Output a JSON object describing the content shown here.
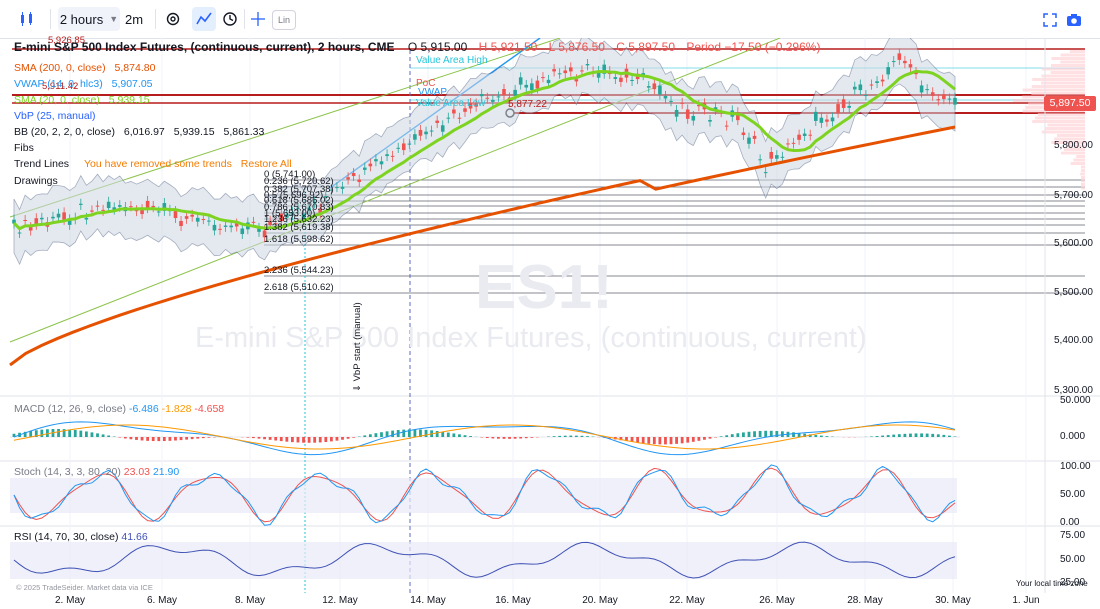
{
  "toolbar": {
    "interval": "2 hours",
    "interval_alt": "2m",
    "lin_label": "Lin"
  },
  "header": {
    "title": "E-mini S&P 500 Index Futures, (continuous, current), 2 hours, CME",
    "open": "O 5,915.00",
    "high": "H 5,921.50",
    "low": "L 5,876.50",
    "close": "C 5,897.50",
    "period": "Period −17.50 (−0.296%)",
    "hi_tag": "5,926.85",
    "level_tag": "5,911.42"
  },
  "legend": {
    "sma200": {
      "label": "SMA (200, 0, close)",
      "value": "5,874.80"
    },
    "vwap": {
      "label": "VWAP (14, 0, hlc3)",
      "value": "5,907.05"
    },
    "sma20": {
      "label": "SMA (20, 0, close)",
      "value": "5,939.15"
    },
    "vbp": {
      "label": "VbP (25, manual)"
    },
    "bb": {
      "label": "BB (20, 2, 2, 0, close)",
      "v1": "6,016.97",
      "v2": "5,939.15",
      "v3": "5,861.33"
    },
    "fibs": "Fibs",
    "trend": "Trend Lines",
    "trend_note": "You have removed some trends",
    "restore": "Restore All",
    "drawings": "Drawings"
  },
  "annotations": {
    "value_area_high": "Value Area High",
    "poc": "PoC",
    "vwap_label": "VWAP",
    "value_area_low": "Value Area Low",
    "point_label": "5,877.22",
    "vbp_start": "⇓ VbP start (manual)"
  },
  "fibs": [
    {
      "text": "0 (5,741.00)"
    },
    {
      "text": "0.236 (5,720.62)"
    },
    {
      "text": "0.382 (5,707.38)"
    },
    {
      "text": "0.5 (5,696.92)"
    },
    {
      "text": "0.618 (5,686.02)"
    },
    {
      "text": "0.786 (5,670.83)"
    },
    {
      "text": "1 (5,653.00)"
    },
    {
      "text": "1.236 (5,632.23)"
    },
    {
      "text": "1.382 (5,619.38)"
    },
    {
      "text": "1.618 (5,598.62)"
    },
    {
      "text": "2.236 (5,544.23)"
    },
    {
      "text": "2.618 (5,510.62)"
    }
  ],
  "price_axis": [
    "5,800.00",
    "5,700.00",
    "5,600.00",
    "5,500.00",
    "5,400.00",
    "5,300.00"
  ],
  "price_tag": "5,897.50",
  "macd": {
    "label": "MACD (12, 26, 9, close)",
    "v1": "-6.486",
    "v2": "-1.828",
    "v3": "-4.658",
    "axis": [
      "50.000",
      "0.000"
    ]
  },
  "stoch": {
    "label": "Stoch (14, 3, 3, 80, 20)",
    "v1": "23.03",
    "v2": "21.90",
    "axis": [
      "100.00",
      "50.00",
      "0.00"
    ]
  },
  "rsi": {
    "label": "RSI (14, 70, 30, close)",
    "v1": "41.66",
    "axis": [
      "75.00",
      "50.00",
      "25.00"
    ]
  },
  "x_axis": [
    "2. May",
    "6. May",
    "8. May",
    "12. May",
    "14. May",
    "16. May",
    "20. May",
    "22. May",
    "26. May",
    "28. May",
    "30. May",
    "1. Jun"
  ],
  "watermark": {
    "symbol": "ES1!",
    "name": "E-mini S&P 500 Index Futures, (continuous, current)"
  },
  "footer": {
    "credit": "© 2025 TradeSeider. Market data via ICE",
    "local_time": "Your local time zone"
  },
  "colors": {
    "up": "#26a69a",
    "down": "#ef5350",
    "sma200": "#e65100",
    "sma20": "#7ed321",
    "bb": "#5b6b8c",
    "vwap": "#2196f3",
    "red_lines": "#b71c1c"
  }
}
